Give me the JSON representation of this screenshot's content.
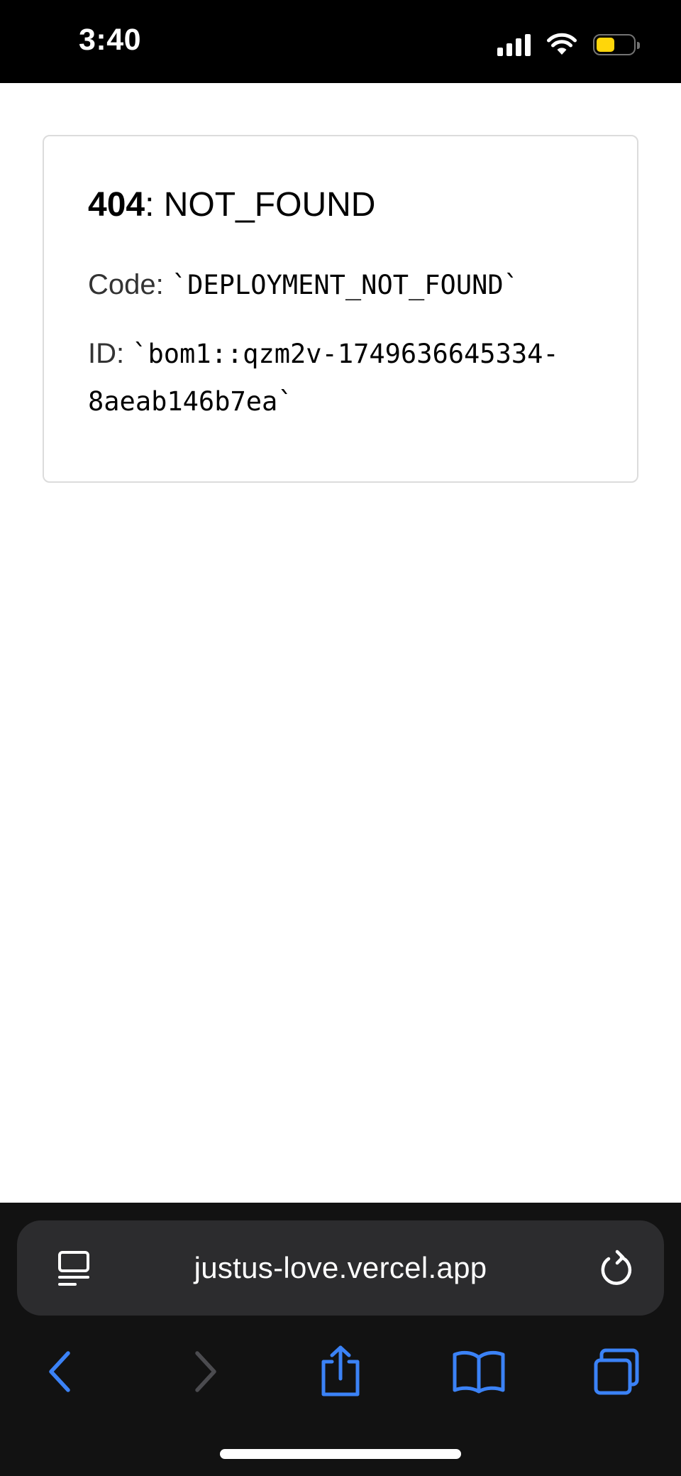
{
  "status_bar": {
    "time": "3:40",
    "icons": [
      "cellular-signal-icon",
      "wifi-icon",
      "battery-icon"
    ],
    "battery_level": 0.5,
    "battery_color": "#ffd60a"
  },
  "error_card": {
    "status_code": "404",
    "separator": ": ",
    "status_text": "NOT_FOUND",
    "code_label": "Code: ",
    "code_value": "`DEPLOYMENT_NOT_FOUND`",
    "id_label": "ID: ",
    "id_value": "`bom1::qzm2v-1749636645334-8aeab146b7ea`"
  },
  "browser": {
    "address": "justus-love.vercel.app",
    "accent_color": "#3b82f6",
    "toolbar": [
      {
        "name": "back-button",
        "icon": "chevron-left-icon",
        "enabled": true
      },
      {
        "name": "forward-button",
        "icon": "chevron-right-icon",
        "enabled": false
      },
      {
        "name": "share-button",
        "icon": "share-icon",
        "enabled": true
      },
      {
        "name": "bookmarks-button",
        "icon": "book-icon",
        "enabled": true
      },
      {
        "name": "tabs-button",
        "icon": "tabs-icon",
        "enabled": true
      }
    ]
  }
}
